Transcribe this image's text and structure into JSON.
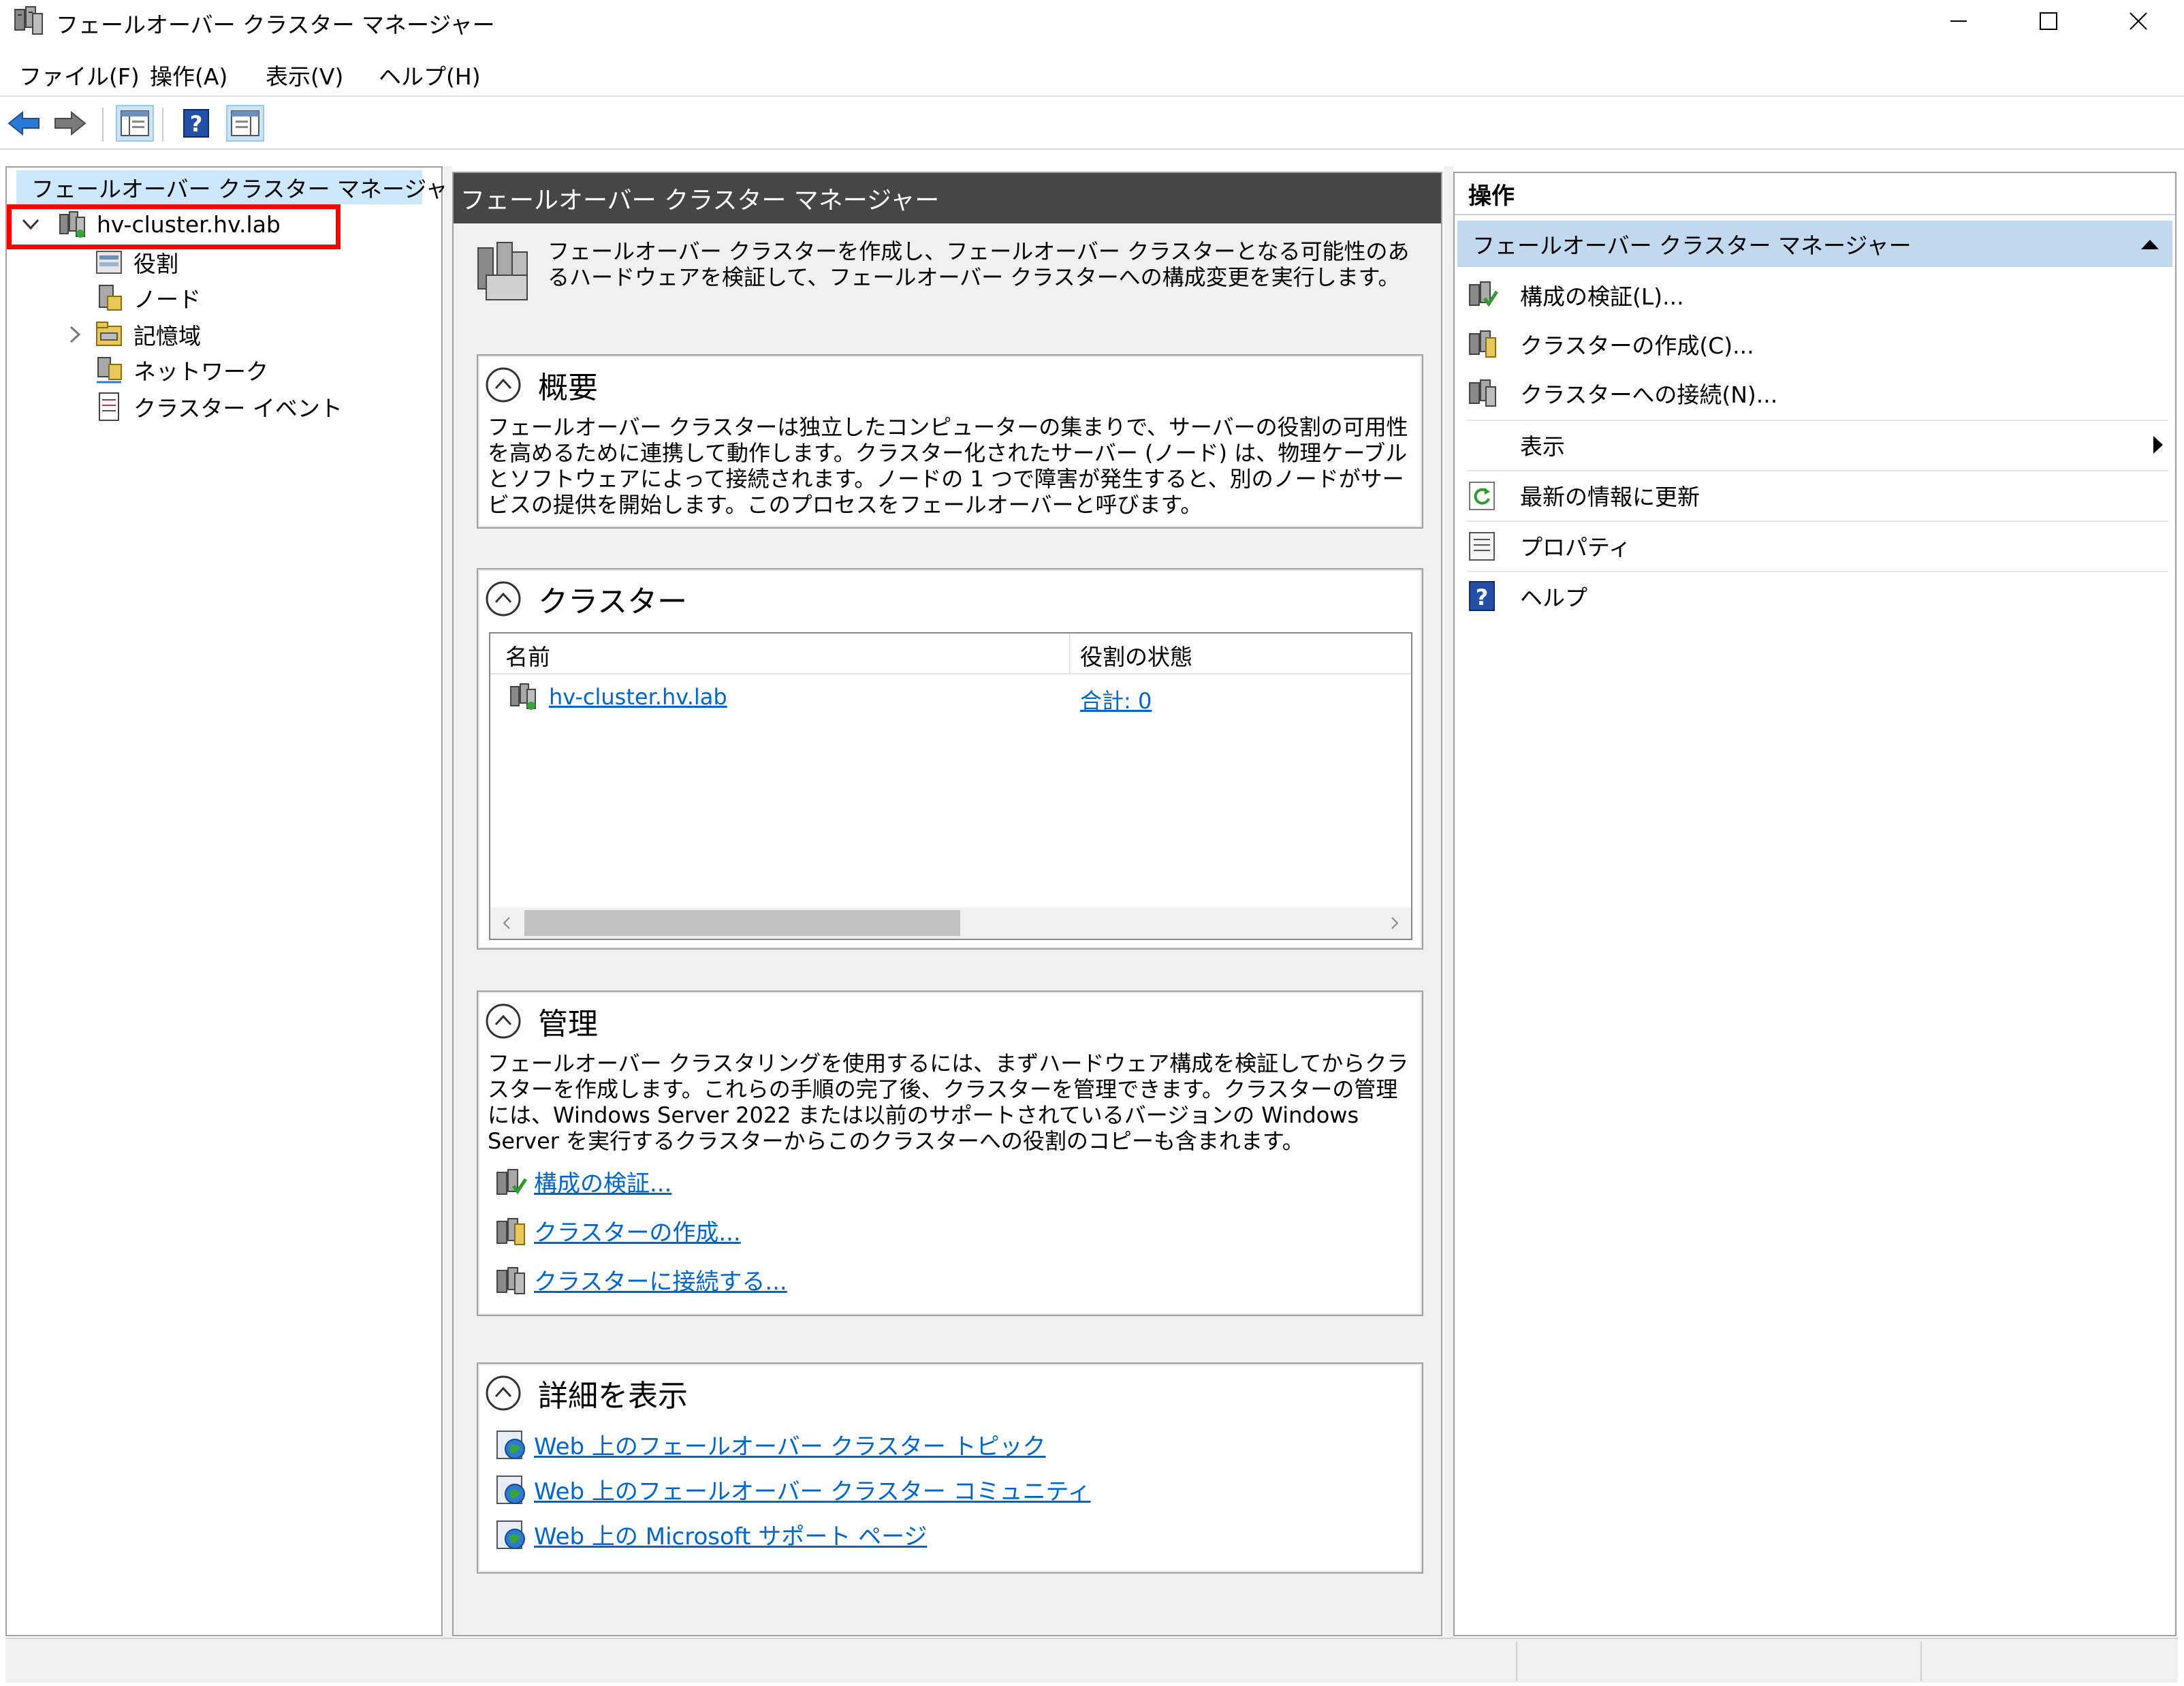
{
  "window": {
    "title": "フェールオーバー クラスター マネージャー"
  },
  "menu": [
    "ファイル(F)",
    "操作(A)",
    "表示(V)",
    "ヘルプ(H)"
  ],
  "tree": {
    "root": "フェールオーバー クラスター マネージャー",
    "cluster": "hv-cluster.hv.lab",
    "children": [
      "役割",
      "ノード",
      "記憶域",
      "ネットワーク",
      "クラスター イベント"
    ]
  },
  "center": {
    "header": "フェールオーバー クラスター マネージャー",
    "intro": "フェールオーバー クラスターを作成し、フェールオーバー クラスターとなる可能性のあるハードウェアを検証して、フェールオーバー クラスターへの構成変更を実行します。",
    "overview": {
      "title": "概要",
      "body": "フェールオーバー クラスターは独立したコンピューターの集まりで、サーバーの役割の可用性を高めるために連携して動作します。クラスター化されたサーバー (ノード) は、物理ケーブルとソフトウェアによって接続されます。ノードの 1 つで障害が発生すると、別のノードがサービスの提供を開始します。このプロセスをフェールオーバーと呼びます。"
    },
    "clusters": {
      "title": "クラスター",
      "columns": [
        "名前",
        "役割の状態"
      ],
      "rows": [
        {
          "name": "hv-cluster.hv.lab",
          "status": "合計: 0"
        }
      ]
    },
    "management": {
      "title": "管理",
      "body": "フェールオーバー クラスタリングを使用するには、まずハードウェア構成を検証してからクラスターを作成します。これらの手順の完了後、クラスターを管理できます。クラスターの管理には、Windows Server 2022 または以前のサポートされているバージョンの Windows Server を実行するクラスターからこのクラスターへの役割のコピーも含まれます。",
      "links": [
        "構成の検証...",
        "クラスターの作成...",
        "クラスターに接続する..."
      ]
    },
    "more_info": {
      "title": "詳細を表示",
      "links": [
        "Web 上のフェールオーバー クラスター トピック",
        "Web 上のフェールオーバー クラスター コミュニティ",
        "Web 上の Microsoft サポート ページ"
      ]
    }
  },
  "actions": {
    "title": "操作",
    "group": "フェールオーバー クラスター マネージャー",
    "items": [
      "構成の検証(L)...",
      "クラスターの作成(C)...",
      "クラスターへの接続(N)...",
      "表示",
      "最新の情報に更新",
      "プロパティ",
      "ヘルプ"
    ]
  }
}
